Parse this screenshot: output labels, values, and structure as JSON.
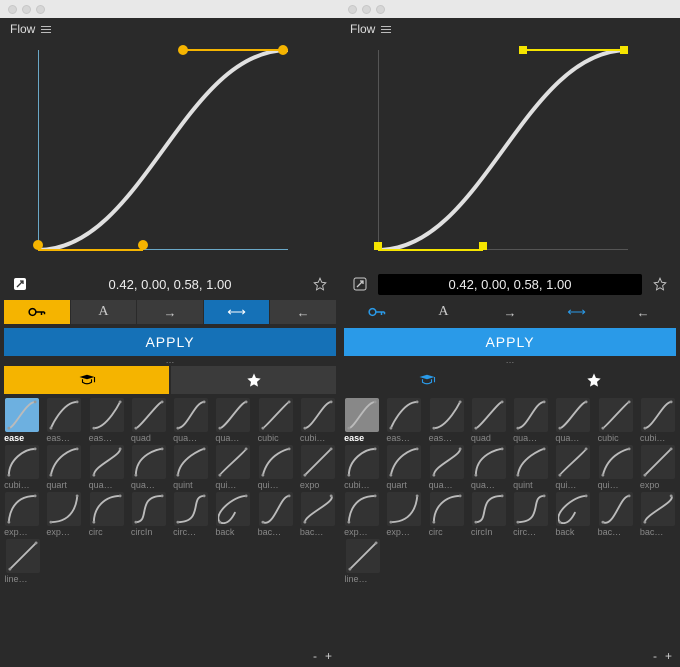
{
  "left": {
    "title": "Flow",
    "bezier_text": "0.42, 0.00, 0.58, 1.00",
    "apply_label": "APPLY",
    "accent": "#f5b400",
    "axis_color": "#6aa8c7",
    "handle_shape": "circle",
    "value_bg": "none",
    "apply_class": "apply-dark",
    "tab_mode": "yellow"
  },
  "right": {
    "title": "Flow",
    "bezier_text": "0.42, 0.00, 0.58, 1.00",
    "apply_label": "APPLY",
    "accent": "#f5e400",
    "axis_color": "#555",
    "handle_shape": "square",
    "value_bg": "dark",
    "apply_class": "apply-light",
    "tab_mode": "blue"
  },
  "modes": [
    "key",
    "text",
    "arrow-right",
    "arrow-both",
    "arrow-left"
  ],
  "presets": [
    [
      "ease",
      "eas…",
      "eas…",
      "quad",
      "qua…",
      "qua…",
      "cubic",
      "cubi…"
    ],
    [
      "cubi…",
      "quart",
      "qua…",
      "qua…",
      "quint",
      "qui…",
      "qui…",
      "expo"
    ],
    [
      "exp…",
      "exp…",
      "circ",
      "circIn",
      "circ…",
      "back",
      "bac…",
      "bac…"
    ],
    [
      "line…"
    ]
  ],
  "footer": {
    "minus": "-",
    "plus": "+"
  }
}
